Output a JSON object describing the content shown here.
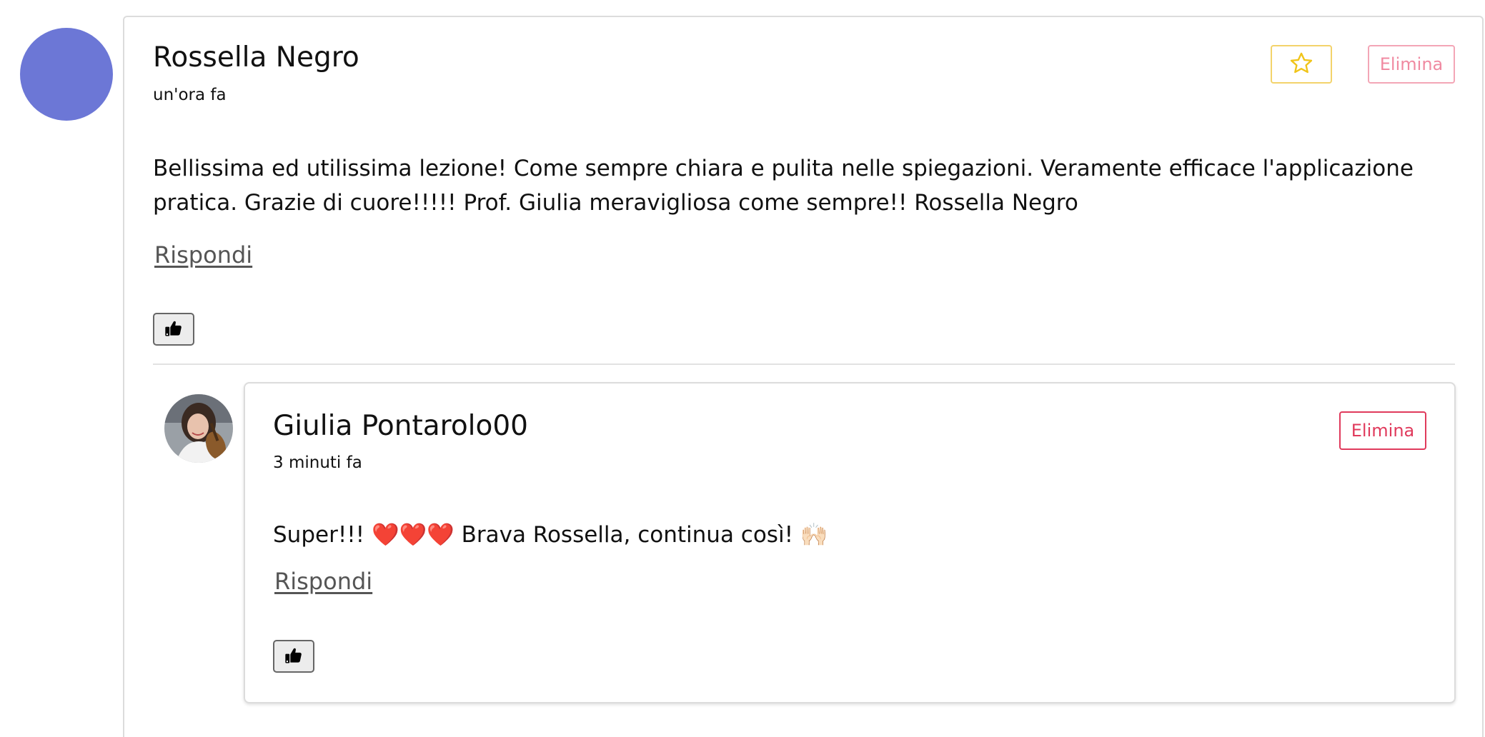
{
  "comment": {
    "author": "Rossella Negro",
    "time": "un'ora fa",
    "favorite_icon": "star-icon",
    "delete_label": "Elimina",
    "text": "Bellissima ed utilissima lezione! Come sempre chiara e pulita nelle spiegazioni. Veramente efficace l'applicazione pratica. Grazie di cuore!!!!! Prof. Giulia meravigliosa come sempre!! Rossella Negro",
    "reply_label": "Rispondi",
    "like_icon": "thumbs-up-icon",
    "avatar_color": "#6c77d6"
  },
  "reply": {
    "author": "Giulia Pontarolo00",
    "time": "3 minuti fa",
    "delete_label": "Elimina",
    "text": "Super!!! ❤️❤️❤️ Brava Rossella, continua così! 🙌🏻",
    "reply_label": "Rispondi",
    "like_icon": "thumbs-up-icon"
  },
  "colors": {
    "favorite_border": "#f3d36b",
    "delete_faded": "#f08aa1",
    "delete_active": "#e03a5c",
    "link": "#555555"
  }
}
